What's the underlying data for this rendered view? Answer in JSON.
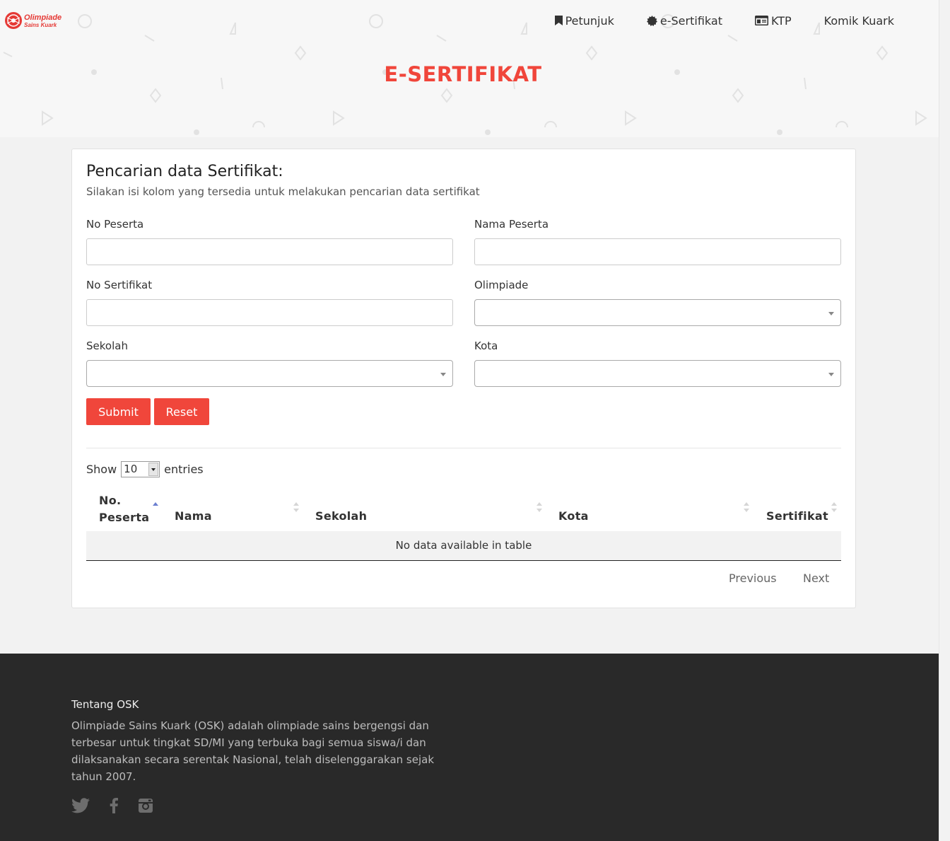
{
  "header": {
    "logo_text": "Olimpiade Sains Kuark",
    "nav": [
      {
        "label": "Petunjuk",
        "icon": "bookmark-icon"
      },
      {
        "label": "e-Sertifikat",
        "icon": "badge-icon"
      },
      {
        "label": "KTP",
        "icon": "id-card-icon"
      },
      {
        "label": "Komik Kuark",
        "icon": ""
      }
    ],
    "title": "E-SERTIFIKAT"
  },
  "search": {
    "title": "Pencarian data Sertifikat:",
    "subtitle": "Silakan isi kolom yang tersedia untuk melakukan pencarian data sertifikat",
    "fields": {
      "no_peserta": {
        "label": "No Peserta",
        "value": ""
      },
      "nama_peserta": {
        "label": "Nama Peserta",
        "value": ""
      },
      "no_sertifikat": {
        "label": "No Sertifikat",
        "value": ""
      },
      "olimpiade": {
        "label": "Olimpiade",
        "value": ""
      },
      "sekolah": {
        "label": "Sekolah",
        "value": ""
      },
      "kota": {
        "label": "Kota",
        "value": ""
      }
    },
    "submit_label": "Submit",
    "reset_label": "Reset"
  },
  "table": {
    "show_label": "Show",
    "entries_value": "10",
    "entries_label": "entries",
    "columns": [
      "No. Peserta",
      "Nama",
      "Sekolah",
      "Kota",
      "Sertifikat"
    ],
    "col0_line1": "No.",
    "col0_line2": "Peserta",
    "empty_text": "No data available in table",
    "previous_label": "Previous",
    "next_label": "Next"
  },
  "footer": {
    "title": "Tentang OSK",
    "text": "Olimpiade Sains Kuark (OSK) adalah olimpiade sains bergengsi dan terbesar untuk tingkat SD/MI yang terbuka bagi semua siswa/i dan dilaksanakan secara serentak Nasional, telah diselenggarakan sejak tahun 2007.",
    "social": [
      "twitter-icon",
      "facebook-icon",
      "instagram-icon"
    ]
  },
  "colors": {
    "accent": "#f0463b",
    "footer_bg": "#292929",
    "page_bg": "#f2f2f2"
  }
}
